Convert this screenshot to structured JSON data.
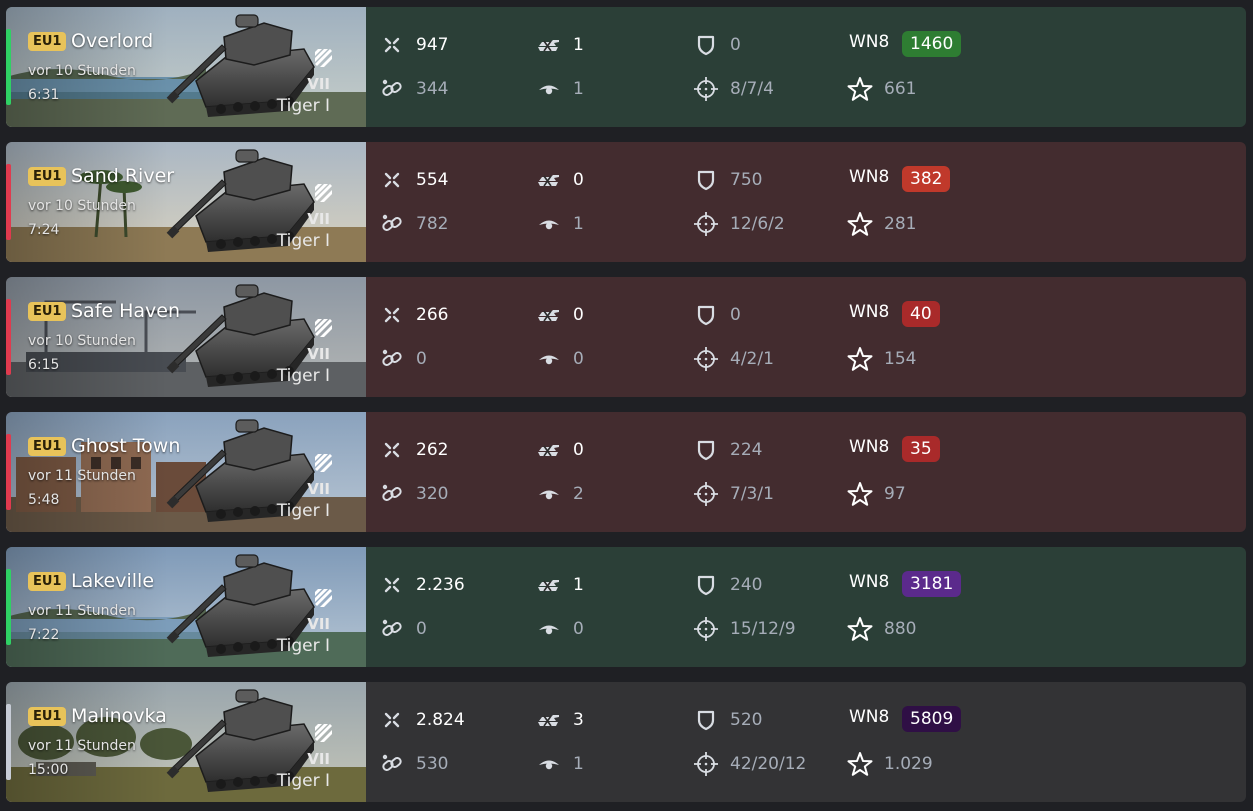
{
  "colors": {
    "win_bg": "#2b3f37",
    "loss_bg": "#432c2f",
    "draw_bg": "#333335",
    "win_bar": "#2fd164",
    "loss_bar": "#e03a4e",
    "draw_bar": "#c7ccd6",
    "server_badge": "#e8c35a",
    "wn8_green": "#2e7d32",
    "wn8_red": "#c0392b",
    "wn8_darkred": "#a92a2a",
    "wn8_purple": "#5b2a8c",
    "wn8_darkpurple": "#2f0f45"
  },
  "icons": {
    "damage": "crossed-swords-icon",
    "assist": "chain-link-icon",
    "frags": "destroyed-tank-icon",
    "spotted": "eye-icon",
    "blocked": "shield-icon",
    "shots": "crosshair-icon",
    "xp": "star-icon",
    "tank_class": "heavy-tank-class-icon"
  },
  "battles": [
    {
      "result": "win",
      "server": "EU1",
      "map": "Overlord",
      "time_ago": "vor 10 Stunden",
      "duration": "6:31",
      "tier": "VII",
      "tank": "Tiger I",
      "damage": "947",
      "assist": "344",
      "frags": "1",
      "spotted": "1",
      "blocked": "0",
      "shots": "8/7/4",
      "wn8_label": "WN8",
      "wn8": "1460",
      "wn8_color": "#2e7d32",
      "xp": "661",
      "map_scene": "coast"
    },
    {
      "result": "loss",
      "server": "EU1",
      "map": "Sand River",
      "time_ago": "vor 10 Stunden",
      "duration": "7:24",
      "tier": "VII",
      "tank": "Tiger I",
      "damage": "554",
      "assist": "782",
      "frags": "0",
      "spotted": "1",
      "blocked": "750",
      "shots": "12/6/2",
      "wn8_label": "WN8",
      "wn8": "382",
      "wn8_color": "#c0392b",
      "xp": "281",
      "map_scene": "desert"
    },
    {
      "result": "loss",
      "server": "EU1",
      "map": "Safe Haven",
      "time_ago": "vor 10 Stunden",
      "duration": "6:15",
      "tier": "VII",
      "tank": "Tiger I",
      "damage": "266",
      "assist": "0",
      "frags": "0",
      "spotted": "0",
      "blocked": "0",
      "shots": "4/2/1",
      "wn8_label": "WN8",
      "wn8": "40",
      "wn8_color": "#a92a2a",
      "xp": "154",
      "map_scene": "harbor"
    },
    {
      "result": "loss",
      "server": "EU1",
      "map": "Ghost Town",
      "time_ago": "vor 11 Stunden",
      "duration": "5:48",
      "tier": "VII",
      "tank": "Tiger I",
      "damage": "262",
      "assist": "320",
      "frags": "0",
      "spotted": "2",
      "blocked": "224",
      "shots": "7/3/1",
      "wn8_label": "WN8",
      "wn8": "35",
      "wn8_color": "#a92a2a",
      "xp": "97",
      "map_scene": "town"
    },
    {
      "result": "win",
      "server": "EU1",
      "map": "Lakeville",
      "time_ago": "vor 11 Stunden",
      "duration": "7:22",
      "tier": "VII",
      "tank": "Tiger I",
      "damage": "2.236",
      "assist": "0",
      "frags": "1",
      "spotted": "0",
      "blocked": "240",
      "shots": "15/12/9",
      "wn8_label": "WN8",
      "wn8": "3181",
      "wn8_color": "#5b2a8c",
      "xp": "880",
      "map_scene": "lake"
    },
    {
      "result": "draw",
      "server": "EU1",
      "map": "Malinovka",
      "time_ago": "vor 11 Stunden",
      "duration": "15:00",
      "tier": "VII",
      "tank": "Tiger I",
      "damage": "2.824",
      "assist": "530",
      "frags": "3",
      "spotted": "1",
      "blocked": "520",
      "shots": "42/20/12",
      "wn8_label": "WN8",
      "wn8": "5809",
      "wn8_color": "#2f0f45",
      "xp": "1.029",
      "map_scene": "field"
    }
  ]
}
